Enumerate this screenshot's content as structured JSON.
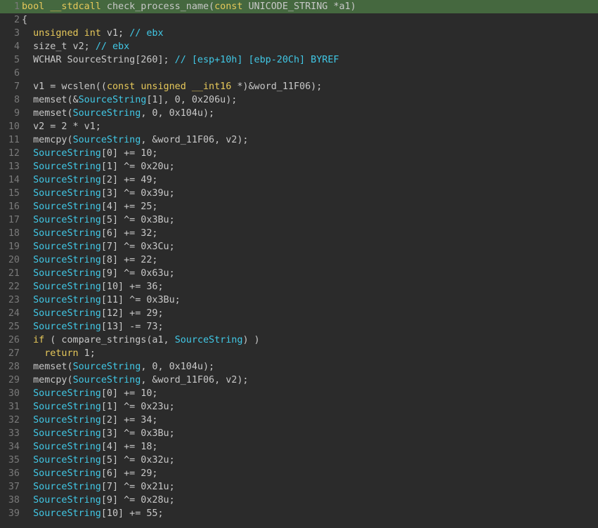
{
  "editor": {
    "language": "IDA Pseudocode (C)",
    "current_line": 1,
    "colors": {
      "background": "#2b2b2b",
      "current_line": "#45683f",
      "keyword": "#e6c85a",
      "variable": "#41c8e6",
      "line_number": "#7a7a7a",
      "plain": "#c8c8c8"
    },
    "lines": [
      {
        "n": "1",
        "tokens": [
          [
            "kw",
            "bool"
          ],
          [
            "pl",
            " "
          ],
          [
            "kw",
            "__stdcall"
          ],
          [
            "pl",
            " check_process_name("
          ],
          [
            "kw",
            "const"
          ],
          [
            "pl",
            " UNICODE_STRING *a1)"
          ]
        ]
      },
      {
        "n": "2",
        "tokens": [
          [
            "pl",
            "{"
          ]
        ]
      },
      {
        "n": "3",
        "tokens": [
          [
            "pl",
            "  "
          ],
          [
            "kw",
            "unsigned"
          ],
          [
            "pl",
            " "
          ],
          [
            "kw",
            "int"
          ],
          [
            "pl",
            " v1; "
          ],
          [
            "cm",
            "// ebx"
          ]
        ]
      },
      {
        "n": "4",
        "tokens": [
          [
            "pl",
            "  size_t v2; "
          ],
          [
            "cm",
            "// ebx"
          ]
        ]
      },
      {
        "n": "5",
        "tokens": [
          [
            "pl",
            "  WCHAR SourceString[260]; "
          ],
          [
            "cm",
            "// [esp+10h] [ebp-20Ch] BYREF"
          ]
        ]
      },
      {
        "n": "6",
        "tokens": [
          [
            "pl",
            ""
          ]
        ]
      },
      {
        "n": "7",
        "tokens": [
          [
            "pl",
            "  v1 = wcslen(("
          ],
          [
            "kw",
            "const"
          ],
          [
            "pl",
            " "
          ],
          [
            "kw",
            "unsigned"
          ],
          [
            "pl",
            " "
          ],
          [
            "kw",
            "__int16"
          ],
          [
            "pl",
            " *)&word_11F06);"
          ]
        ]
      },
      {
        "n": "8",
        "tokens": [
          [
            "pl",
            "  memset(&"
          ],
          [
            "var",
            "SourceString"
          ],
          [
            "pl",
            "[1], 0, 0x206u);"
          ]
        ]
      },
      {
        "n": "9",
        "tokens": [
          [
            "pl",
            "  memset("
          ],
          [
            "var",
            "SourceString"
          ],
          [
            "pl",
            ", 0, 0x104u);"
          ]
        ]
      },
      {
        "n": "10",
        "tokens": [
          [
            "pl",
            "  v2 = 2 * v1;"
          ]
        ]
      },
      {
        "n": "11",
        "tokens": [
          [
            "pl",
            "  memcpy("
          ],
          [
            "var",
            "SourceString"
          ],
          [
            "pl",
            ", &word_11F06, v2);"
          ]
        ]
      },
      {
        "n": "12",
        "tokens": [
          [
            "pl",
            "  "
          ],
          [
            "var",
            "SourceString"
          ],
          [
            "pl",
            "[0] += 10;"
          ]
        ]
      },
      {
        "n": "13",
        "tokens": [
          [
            "pl",
            "  "
          ],
          [
            "var",
            "SourceString"
          ],
          [
            "pl",
            "[1] ^= 0x20u;"
          ]
        ]
      },
      {
        "n": "14",
        "tokens": [
          [
            "pl",
            "  "
          ],
          [
            "var",
            "SourceString"
          ],
          [
            "pl",
            "[2] += 49;"
          ]
        ]
      },
      {
        "n": "15",
        "tokens": [
          [
            "pl",
            "  "
          ],
          [
            "var",
            "SourceString"
          ],
          [
            "pl",
            "[3] ^= 0x39u;"
          ]
        ]
      },
      {
        "n": "16",
        "tokens": [
          [
            "pl",
            "  "
          ],
          [
            "var",
            "SourceString"
          ],
          [
            "pl",
            "[4] += 25;"
          ]
        ]
      },
      {
        "n": "17",
        "tokens": [
          [
            "pl",
            "  "
          ],
          [
            "var",
            "SourceString"
          ],
          [
            "pl",
            "[5] ^= 0x3Bu;"
          ]
        ]
      },
      {
        "n": "18",
        "tokens": [
          [
            "pl",
            "  "
          ],
          [
            "var",
            "SourceString"
          ],
          [
            "pl",
            "[6] += 32;"
          ]
        ]
      },
      {
        "n": "19",
        "tokens": [
          [
            "pl",
            "  "
          ],
          [
            "var",
            "SourceString"
          ],
          [
            "pl",
            "[7] ^= 0x3Cu;"
          ]
        ]
      },
      {
        "n": "20",
        "tokens": [
          [
            "pl",
            "  "
          ],
          [
            "var",
            "SourceString"
          ],
          [
            "pl",
            "[8] += 22;"
          ]
        ]
      },
      {
        "n": "21",
        "tokens": [
          [
            "pl",
            "  "
          ],
          [
            "var",
            "SourceString"
          ],
          [
            "pl",
            "[9] ^= 0x63u;"
          ]
        ]
      },
      {
        "n": "22",
        "tokens": [
          [
            "pl",
            "  "
          ],
          [
            "var",
            "SourceString"
          ],
          [
            "pl",
            "[10] += 36;"
          ]
        ]
      },
      {
        "n": "23",
        "tokens": [
          [
            "pl",
            "  "
          ],
          [
            "var",
            "SourceString"
          ],
          [
            "pl",
            "[11] ^= 0x3Bu;"
          ]
        ]
      },
      {
        "n": "24",
        "tokens": [
          [
            "pl",
            "  "
          ],
          [
            "var",
            "SourceString"
          ],
          [
            "pl",
            "[12] += 29;"
          ]
        ]
      },
      {
        "n": "25",
        "tokens": [
          [
            "pl",
            "  "
          ],
          [
            "var",
            "SourceString"
          ],
          [
            "pl",
            "[13] -= 73;"
          ]
        ]
      },
      {
        "n": "26",
        "tokens": [
          [
            "pl",
            "  "
          ],
          [
            "kw",
            "if"
          ],
          [
            "pl",
            " ( compare_strings(a1, "
          ],
          [
            "var",
            "SourceString"
          ],
          [
            "pl",
            ") )"
          ]
        ]
      },
      {
        "n": "27",
        "tokens": [
          [
            "pl",
            "    "
          ],
          [
            "kw",
            "return"
          ],
          [
            "pl",
            " 1;"
          ]
        ]
      },
      {
        "n": "28",
        "tokens": [
          [
            "pl",
            "  memset("
          ],
          [
            "var",
            "SourceString"
          ],
          [
            "pl",
            ", 0, 0x104u);"
          ]
        ]
      },
      {
        "n": "29",
        "tokens": [
          [
            "pl",
            "  memcpy("
          ],
          [
            "var",
            "SourceString"
          ],
          [
            "pl",
            ", &word_11F06, v2);"
          ]
        ]
      },
      {
        "n": "30",
        "tokens": [
          [
            "pl",
            "  "
          ],
          [
            "var",
            "SourceString"
          ],
          [
            "pl",
            "[0] += 10;"
          ]
        ]
      },
      {
        "n": "31",
        "tokens": [
          [
            "pl",
            "  "
          ],
          [
            "var",
            "SourceString"
          ],
          [
            "pl",
            "[1] ^= 0x23u;"
          ]
        ]
      },
      {
        "n": "32",
        "tokens": [
          [
            "pl",
            "  "
          ],
          [
            "var",
            "SourceString"
          ],
          [
            "pl",
            "[2] += 34;"
          ]
        ]
      },
      {
        "n": "33",
        "tokens": [
          [
            "pl",
            "  "
          ],
          [
            "var",
            "SourceString"
          ],
          [
            "pl",
            "[3] ^= 0x3Bu;"
          ]
        ]
      },
      {
        "n": "34",
        "tokens": [
          [
            "pl",
            "  "
          ],
          [
            "var",
            "SourceString"
          ],
          [
            "pl",
            "[4] += 18;"
          ]
        ]
      },
      {
        "n": "35",
        "tokens": [
          [
            "pl",
            "  "
          ],
          [
            "var",
            "SourceString"
          ],
          [
            "pl",
            "[5] ^= 0x32u;"
          ]
        ]
      },
      {
        "n": "36",
        "tokens": [
          [
            "pl",
            "  "
          ],
          [
            "var",
            "SourceString"
          ],
          [
            "pl",
            "[6] += 29;"
          ]
        ]
      },
      {
        "n": "37",
        "tokens": [
          [
            "pl",
            "  "
          ],
          [
            "var",
            "SourceString"
          ],
          [
            "pl",
            "[7] ^= 0x21u;"
          ]
        ]
      },
      {
        "n": "38",
        "tokens": [
          [
            "pl",
            "  "
          ],
          [
            "var",
            "SourceString"
          ],
          [
            "pl",
            "[9] ^= 0x28u;"
          ]
        ]
      },
      {
        "n": "39",
        "tokens": [
          [
            "pl",
            "  "
          ],
          [
            "var",
            "SourceString"
          ],
          [
            "pl",
            "[10] += 55;"
          ]
        ]
      }
    ]
  }
}
